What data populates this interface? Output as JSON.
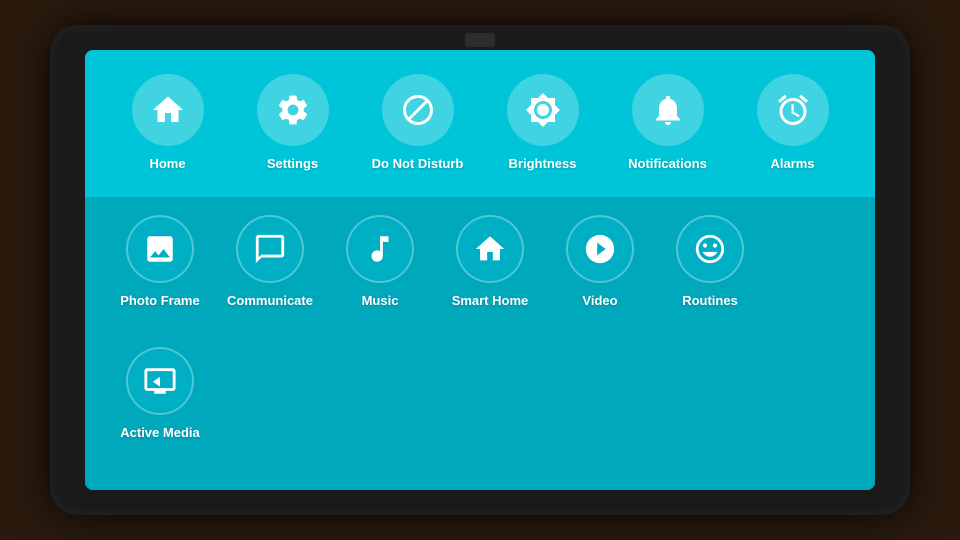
{
  "device": {
    "background": "#1a1a1a"
  },
  "screen": {
    "top_items": [
      {
        "id": "home",
        "label": "Home",
        "icon": "home"
      },
      {
        "id": "settings",
        "label": "Settings",
        "icon": "settings"
      },
      {
        "id": "do-not-disturb",
        "label": "Do Not Disturb",
        "icon": "dnd"
      },
      {
        "id": "brightness",
        "label": "Brightness",
        "icon": "brightness"
      },
      {
        "id": "notifications",
        "label": "Notifications",
        "icon": "bell"
      },
      {
        "id": "alarms",
        "label": "Alarms",
        "icon": "alarm"
      }
    ],
    "bottom_items": [
      {
        "id": "photo-frame",
        "label": "Photo Frame",
        "icon": "photo"
      },
      {
        "id": "communicate",
        "label": "Communicate",
        "icon": "chat"
      },
      {
        "id": "music",
        "label": "Music",
        "icon": "music"
      },
      {
        "id": "smart-home",
        "label": "Smart Home",
        "icon": "home2"
      },
      {
        "id": "video",
        "label": "Video",
        "icon": "play"
      },
      {
        "id": "routines",
        "label": "Routines",
        "icon": "routines"
      },
      {
        "id": "active-media",
        "label": "Active Media",
        "icon": "media"
      }
    ]
  }
}
